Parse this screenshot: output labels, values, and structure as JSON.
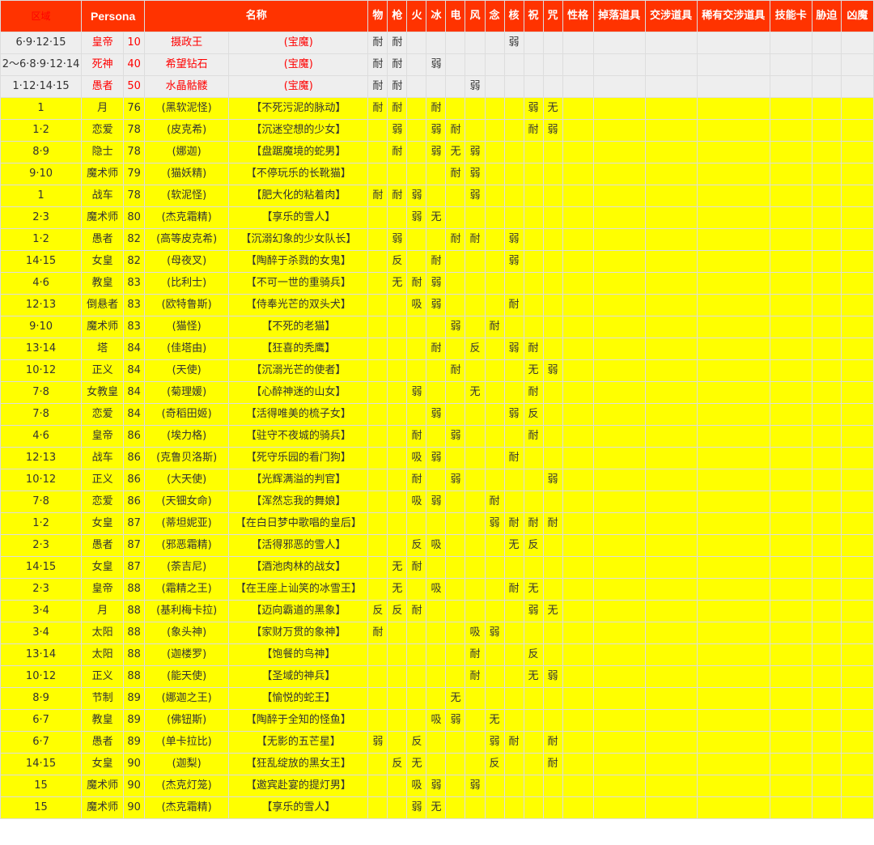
{
  "headers": [
    "区域",
    "Persona",
    "名称",
    "",
    "物",
    "枪",
    "火",
    "冰",
    "电",
    "风",
    "念",
    "核",
    "祝",
    "咒",
    "性格",
    "掉落道具",
    "交涉道具",
    "稀有交涉道具",
    "技能卡",
    "胁迫",
    "凶魔"
  ],
  "rows": [
    {
      "type": "boss",
      "cells": [
        "6·9·12·15",
        "皇帝",
        "10",
        "摄政王",
        "(宝魔)",
        "耐",
        "耐",
        "",
        "",
        "",
        "",
        "",
        "弱",
        "",
        "",
        "",
        "",
        "",
        "",
        "",
        "",
        ""
      ]
    },
    {
      "type": "boss",
      "cells": [
        "2～6·8·9·12·14",
        "死神",
        "40",
        "希望钻石",
        "(宝魔)",
        "耐",
        "耐",
        "",
        "弱",
        "",
        "",
        "",
        "",
        "",
        "",
        "",
        "",
        "",
        "",
        "",
        "",
        ""
      ]
    },
    {
      "type": "boss",
      "cells": [
        "1·12·14·15",
        "愚者",
        "50",
        "水晶骷髅",
        "(宝魔)",
        "耐",
        "耐",
        "",
        "",
        "",
        "弱",
        "",
        "",
        "",
        "",
        "",
        "",
        "",
        "",
        "",
        "",
        ""
      ]
    },
    {
      "type": "normal",
      "cells": [
        "1",
        "月",
        "76",
        "(黑软泥怪)",
        "【不死污泥的脉动】",
        "耐",
        "耐",
        "",
        "耐",
        "",
        "",
        "",
        "",
        "弱",
        "无",
        "",
        "",
        "",
        "",
        "",
        "",
        ""
      ]
    },
    {
      "type": "normal",
      "cells": [
        "1·2",
        "恋爱",
        "78",
        "(皮克希)",
        "【沉迷空想的少女】",
        "",
        "弱",
        "",
        "弱",
        "耐",
        "",
        "",
        "",
        "耐",
        "弱",
        "",
        "",
        "",
        "",
        "",
        "",
        ""
      ]
    },
    {
      "type": "normal",
      "cells": [
        "8·9",
        "隐士",
        "78",
        "(娜迦)",
        "【盘踞魔境的蛇男】",
        "",
        "耐",
        "",
        "弱",
        "无",
        "弱",
        "",
        "",
        "",
        "",
        "",
        "",
        "",
        "",
        "",
        "",
        ""
      ]
    },
    {
      "type": "normal",
      "cells": [
        "9·10",
        "魔术师",
        "79",
        "(猫妖精)",
        "【不停玩乐的长靴猫】",
        "",
        "",
        "",
        "",
        "耐",
        "弱",
        "",
        "",
        "",
        "",
        "",
        "",
        "",
        "",
        "",
        "",
        ""
      ]
    },
    {
      "type": "normal",
      "cells": [
        "1",
        "战车",
        "78",
        "(软泥怪)",
        "【肥大化的粘着肉】",
        "耐",
        "耐",
        "弱",
        "",
        "",
        "弱",
        "",
        "",
        "",
        "",
        "",
        "",
        "",
        "",
        "",
        "",
        ""
      ]
    },
    {
      "type": "normal",
      "cells": [
        "2·3",
        "魔术师",
        "80",
        "(杰克霜精)",
        "【享乐的雪人】",
        "",
        "",
        "弱",
        "无",
        "",
        "",
        "",
        "",
        "",
        "",
        "",
        "",
        "",
        "",
        "",
        "",
        ""
      ]
    },
    {
      "type": "normal",
      "cells": [
        "1·2",
        "愚者",
        "82",
        "(高等皮克希)",
        "【沉溺幻象的少女队长】",
        "",
        "弱",
        "",
        "",
        "耐",
        "耐",
        "",
        "弱",
        "",
        "",
        "",
        "",
        "",
        "",
        "",
        "",
        ""
      ]
    },
    {
      "type": "normal",
      "cells": [
        "14·15",
        "女皇",
        "82",
        "(母夜叉)",
        "【陶醉于杀戮的女鬼】",
        "",
        "反",
        "",
        "耐",
        "",
        "",
        "",
        "弱",
        "",
        "",
        "",
        "",
        "",
        "",
        "",
        "",
        ""
      ]
    },
    {
      "type": "normal",
      "cells": [
        "4·6",
        "教皇",
        "83",
        "(比利士)",
        "【不可一世的重骑兵】",
        "",
        "无",
        "耐",
        "弱",
        "",
        "",
        "",
        "",
        "",
        "",
        "",
        "",
        "",
        "",
        "",
        "",
        ""
      ]
    },
    {
      "type": "normal",
      "cells": [
        "12·13",
        "倒悬者",
        "83",
        "(欧特鲁斯)",
        "【侍奉光芒的双头犬】",
        "",
        "",
        "吸",
        "弱",
        "",
        "",
        "",
        "耐",
        "",
        "",
        "",
        "",
        "",
        "",
        "",
        "",
        ""
      ]
    },
    {
      "type": "normal",
      "cells": [
        "9·10",
        "魔术师",
        "83",
        "(猫怪)",
        "【不死的老猫】",
        "",
        "",
        "",
        "",
        "弱",
        "",
        "耐",
        "",
        "",
        "",
        "",
        "",
        "",
        "",
        "",
        "",
        ""
      ]
    },
    {
      "type": "normal",
      "cells": [
        "13·14",
        "塔",
        "84",
        "(佳塔由)",
        "【狂喜的秃鹰】",
        "",
        "",
        "",
        "耐",
        "",
        "反",
        "",
        "弱",
        "耐",
        "",
        "",
        "",
        "",
        "",
        "",
        "",
        ""
      ]
    },
    {
      "type": "normal",
      "cells": [
        "10·12",
        "正义",
        "84",
        "(天使)",
        "【沉溺光芒的使者】",
        "",
        "",
        "",
        "",
        "耐",
        "",
        "",
        "",
        "无",
        "弱",
        "",
        "",
        "",
        "",
        "",
        "",
        ""
      ]
    },
    {
      "type": "normal",
      "cells": [
        "7·8",
        "女教皇",
        "84",
        "(菊理媛)",
        "【心醉神迷的山女】",
        "",
        "",
        "弱",
        "",
        "",
        "无",
        "",
        "",
        "耐",
        "",
        "",
        "",
        "",
        "",
        "",
        "",
        ""
      ]
    },
    {
      "type": "normal",
      "cells": [
        "7·8",
        "恋爱",
        "84",
        "(奇稻田姬)",
        "【活得唯美的梳子女】",
        "",
        "",
        "",
        "弱",
        "",
        "",
        "",
        "弱",
        "反",
        "",
        "",
        "",
        "",
        "",
        "",
        "",
        ""
      ]
    },
    {
      "type": "normal",
      "cells": [
        "4·6",
        "皇帝",
        "86",
        "(埃力格)",
        "【驻守不夜城的骑兵】",
        "",
        "",
        "耐",
        "",
        "弱",
        "",
        "",
        "",
        "耐",
        "",
        "",
        "",
        "",
        "",
        "",
        "",
        ""
      ]
    },
    {
      "type": "normal",
      "cells": [
        "12·13",
        "战车",
        "86",
        "(克鲁贝洛斯)",
        "【死守乐园的看门狗】",
        "",
        "",
        "吸",
        "弱",
        "",
        "",
        "",
        "耐",
        "",
        "",
        "",
        "",
        "",
        "",
        "",
        "",
        ""
      ]
    },
    {
      "type": "normal",
      "cells": [
        "10·12",
        "正义",
        "86",
        "(大天使)",
        "【光辉满溢的判官】",
        "",
        "",
        "耐",
        "",
        "弱",
        "",
        "",
        "",
        "",
        "弱",
        "",
        "",
        "",
        "",
        "",
        "",
        ""
      ]
    },
    {
      "type": "normal",
      "cells": [
        "7·8",
        "恋爱",
        "86",
        "(天钿女命)",
        "【浑然忘我的舞娘】",
        "",
        "",
        "吸",
        "弱",
        "",
        "",
        "耐",
        "",
        "",
        "",
        "",
        "",
        "",
        "",
        "",
        "",
        ""
      ]
    },
    {
      "type": "normal",
      "cells": [
        "1·2",
        "女皇",
        "87",
        "(蒂坦妮亚)",
        "【在白日梦中歌唱的皇后】",
        "",
        "",
        "",
        "",
        "",
        "",
        "弱",
        "耐",
        "耐",
        "耐",
        "",
        "",
        "",
        "",
        "",
        "",
        ""
      ]
    },
    {
      "type": "normal",
      "cells": [
        "2·3",
        "愚者",
        "87",
        "(邪恶霜精)",
        "【活得邪恶的雪人】",
        "",
        "",
        "反",
        "吸",
        "",
        "",
        "",
        "无",
        "反",
        "",
        "",
        "",
        "",
        "",
        "",
        "",
        ""
      ]
    },
    {
      "type": "normal",
      "cells": [
        "14·15",
        "女皇",
        "87",
        "(荼吉尼)",
        "【酒池肉林的战女】",
        "",
        "无",
        "耐",
        "",
        "",
        "",
        "",
        "",
        "",
        "",
        "",
        "",
        "",
        "",
        "",
        "",
        ""
      ]
    },
    {
      "type": "normal",
      "cells": [
        "2·3",
        "皇帝",
        "88",
        "(霜精之王)",
        "【在王座上讪笑的冰雪王】",
        "",
        "无",
        "",
        "吸",
        "",
        "",
        "",
        "耐",
        "无",
        "",
        "",
        "",
        "",
        "",
        "",
        "",
        ""
      ]
    },
    {
      "type": "normal",
      "cells": [
        "3·4",
        "月",
        "88",
        "(基利梅卡拉)",
        "【迈向霸道的黑象】",
        "反",
        "反",
        "耐",
        "",
        "",
        "",
        "",
        "",
        "弱",
        "无",
        "",
        "",
        "",
        "",
        "",
        "",
        ""
      ]
    },
    {
      "type": "normal",
      "cells": [
        "3·4",
        "太阳",
        "88",
        "(象头神)",
        "【家财万贯的象神】",
        "耐",
        "",
        "",
        "",
        "",
        "吸",
        "弱",
        "",
        "",
        "",
        "",
        "",
        "",
        "",
        "",
        "",
        ""
      ]
    },
    {
      "type": "normal",
      "cells": [
        "13·14",
        "太阳",
        "88",
        "(迦楼罗)",
        "【饱餐的鸟神】",
        "",
        "",
        "",
        "",
        "",
        "耐",
        "",
        "",
        "反",
        "",
        "",
        "",
        "",
        "",
        "",
        "",
        ""
      ]
    },
    {
      "type": "normal",
      "cells": [
        "10·12",
        "正义",
        "88",
        "(能天使)",
        "【圣域的神兵】",
        "",
        "",
        "",
        "",
        "",
        "耐",
        "",
        "",
        "无",
        "弱",
        "",
        "",
        "",
        "",
        "",
        "",
        ""
      ]
    },
    {
      "type": "normal",
      "cells": [
        "8·9",
        "节制",
        "89",
        "(娜迦之王)",
        "【愉悦的蛇王】",
        "",
        "",
        "",
        "",
        "无",
        "",
        "",
        "",
        "",
        "",
        "",
        "",
        "",
        "",
        "",
        "",
        ""
      ]
    },
    {
      "type": "normal",
      "cells": [
        "6·7",
        "教皇",
        "89",
        "(佛钮斯)",
        "【陶醉于全知的怪鱼】",
        "",
        "",
        "",
        "吸",
        "弱",
        "",
        "无",
        "",
        "",
        "",
        "",
        "",
        "",
        "",
        "",
        "",
        ""
      ]
    },
    {
      "type": "normal",
      "cells": [
        "6·7",
        "愚者",
        "89",
        "(单卡拉比)",
        "【无影的五芒星】",
        "弱",
        "",
        "反",
        "",
        "",
        "",
        "弱",
        "耐",
        "",
        "耐",
        "",
        "",
        "",
        "",
        "",
        "",
        ""
      ]
    },
    {
      "type": "normal",
      "cells": [
        "14·15",
        "女皇",
        "90",
        "(迦梨)",
        "【狂乱绽放的黑女王】",
        "",
        "反",
        "无",
        "",
        "",
        "",
        "反",
        "",
        "",
        "耐",
        "",
        "",
        "",
        "",
        "",
        "",
        ""
      ]
    },
    {
      "type": "normal",
      "cells": [
        "15",
        "魔术师",
        "90",
        "(杰克灯笼)",
        "【邀宾赴宴的提灯男】",
        "",
        "",
        "吸",
        "弱",
        "",
        "弱",
        "",
        "",
        "",
        "",
        "",
        "",
        "",
        "",
        "",
        "",
        ""
      ]
    },
    {
      "type": "normal",
      "cells": [
        "15",
        "魔术师",
        "90",
        "(杰克霜精)",
        "【享乐的雪人】",
        "",
        "",
        "弱",
        "无",
        "",
        "",
        "",
        "",
        "",
        "",
        "",
        "",
        "",
        "",
        "",
        "",
        ""
      ]
    }
  ]
}
